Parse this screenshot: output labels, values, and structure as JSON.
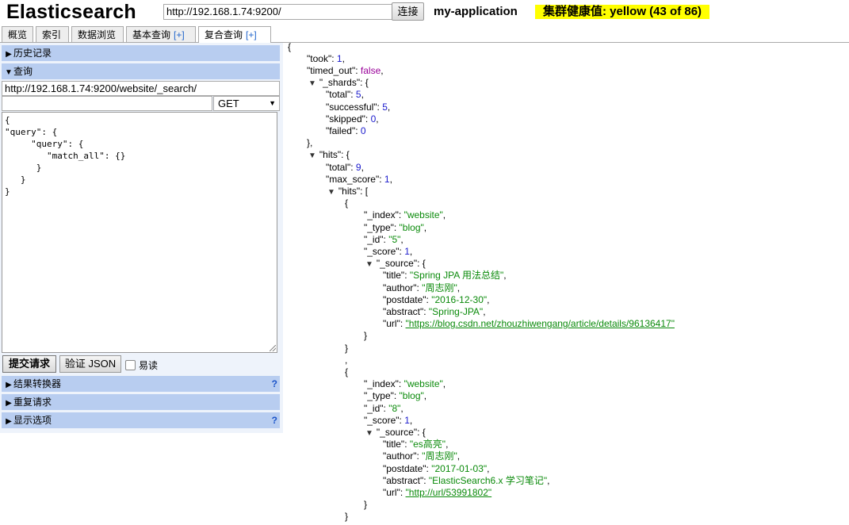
{
  "header": {
    "logo": "Elasticsearch",
    "url_value": "http://192.168.1.74:9200/",
    "connect_label": "连接",
    "cluster_name": "my-application",
    "health": "集群健康值: yellow (43 of 86)",
    "health_color": "#ffff00"
  },
  "tabs": [
    {
      "label": "概览"
    },
    {
      "label": "索引"
    },
    {
      "label": "数据浏览"
    },
    {
      "label": "基本查询",
      "plus": "[+]"
    },
    {
      "label": "复合查询",
      "plus": "[+]"
    }
  ],
  "left": {
    "history_label": "历史记录",
    "query_label": "查询",
    "query_url": "http://192.168.1.74:9200/website/_search/",
    "query_path": "",
    "method": "GET",
    "request_body": "{\n\"query\": {\n     \"query\": {\n        \"match_all\": {}\n      }\n   }\n}",
    "submit_label": "提交请求",
    "validate_label": "验证 JSON",
    "readonly_label": "易读",
    "transformer_label": "结果转换器",
    "repeat_label": "重复请求",
    "display_label": "显示选项",
    "help_mark": "?"
  },
  "result": {
    "took": "1",
    "timed_out": "false",
    "shards": {
      "total": "5",
      "successful": "5",
      "skipped": "0",
      "failed": "0"
    },
    "hits_total": "9",
    "max_score": "1",
    "hits": [
      {
        "_index": "\"website\"",
        "_type": "\"blog\"",
        "_id": "\"5\"",
        "_score": "1",
        "source": {
          "title": "\"Spring JPA 用法总结\"",
          "author": "\"周志刚\"",
          "postdate": "\"2016-12-30\"",
          "abstract": "\"Spring-JPA\"",
          "url": "\"https://blog.csdn.net/zhouzhiwengang/article/details/96136417\""
        }
      },
      {
        "_index": "\"website\"",
        "_type": "\"blog\"",
        "_id": "\"8\"",
        "_score": "1",
        "source": {
          "title": "\"es高亮\"",
          "author": "\"周志刚\"",
          "postdate": "\"2017-01-03\"",
          "abstract": "\"ElasticSearch6.x 学习笔记\"",
          "url": "\"http://url/53991802\""
        }
      }
    ]
  }
}
